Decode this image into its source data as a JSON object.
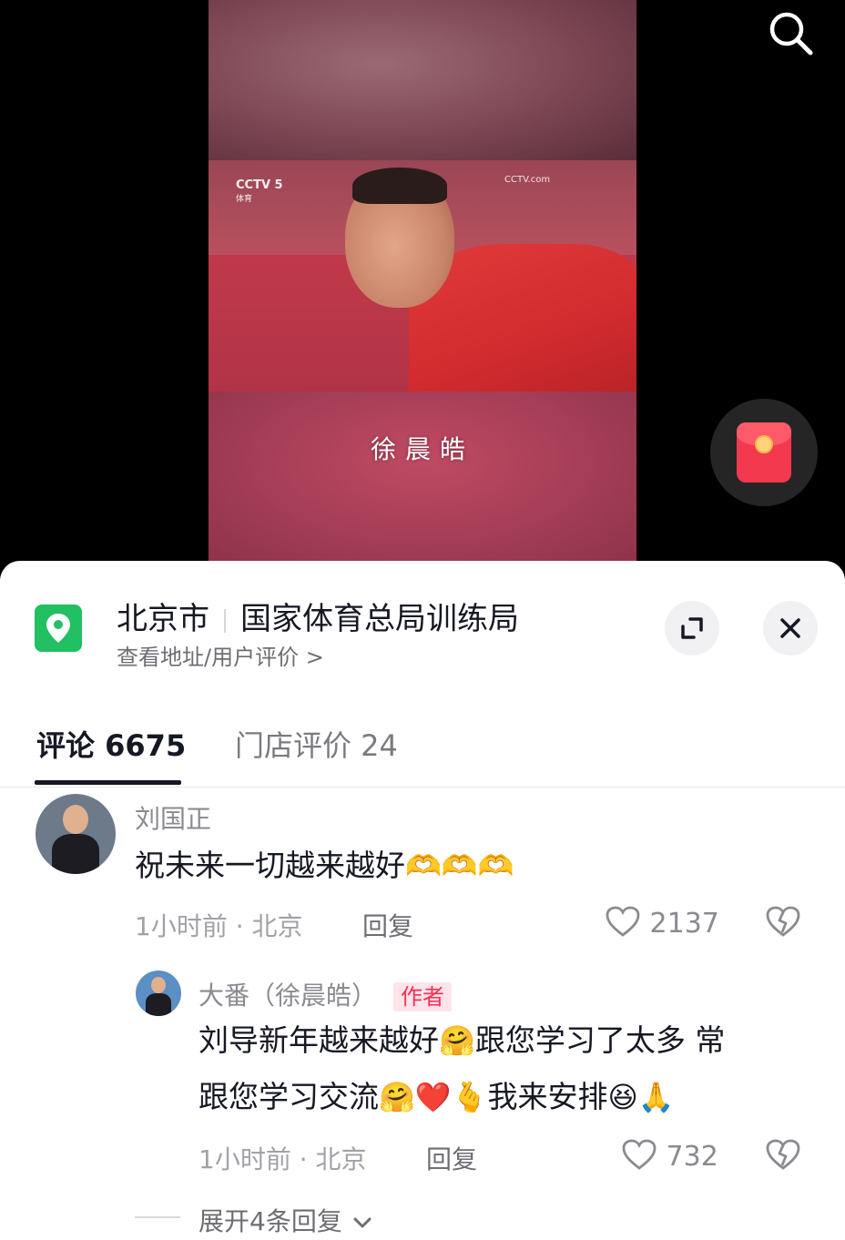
{
  "video": {
    "caption": "徐晨皓",
    "channel_logo": "CCTV 5",
    "channel_sub": "体育",
    "watermark": "CCTV.com"
  },
  "icons": {
    "search": "search-icon",
    "red_packet": "red-packet-icon",
    "location": "location-pin-icon",
    "expand": "expand-icon",
    "close": "close-icon",
    "like": "heart-icon",
    "dislike": "broken-heart-icon",
    "chevron": "chevron-down-icon"
  },
  "colors": {
    "accent": "#fe2c55",
    "location_green": "#21c063"
  },
  "location": {
    "city": "北京市",
    "place": "国家体育总局训练局",
    "subtitle": "查看地址/用户评价 >"
  },
  "tabs": {
    "comments": "评论 6675",
    "reviews": "门店评价 24"
  },
  "comments": [
    {
      "user": "刘国正",
      "text": "祝未来一切越来越好",
      "emojis": "🫶🫶🫶",
      "meta": "1小时前 · 北京",
      "reply_label": "回复",
      "likes": "2137"
    }
  ],
  "reply": {
    "user": "大番（徐晨皓）",
    "badge": "作者",
    "line1_a": "刘导新年越来越好",
    "line1_emoji": "🤗",
    "line1_b": "跟您学习了太多 常",
    "line2_a": "跟您学习交流",
    "line2_emoji": "🤗❤️🫰",
    "line2_b": "我来安排",
    "line2_emoji2": "😆🙏",
    "meta": "1小时前 · 北京",
    "reply_label": "回复",
    "likes": "732"
  },
  "expand_more": "展开4条回复"
}
